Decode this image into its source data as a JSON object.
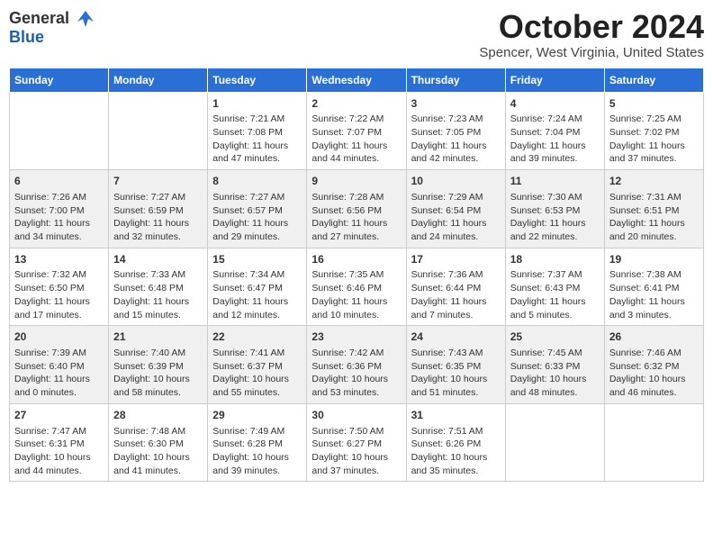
{
  "header": {
    "logo_line1": "General",
    "logo_line2": "Blue",
    "month_title": "October 2024",
    "location": "Spencer, West Virginia, United States"
  },
  "weekdays": [
    "Sunday",
    "Monday",
    "Tuesday",
    "Wednesday",
    "Thursday",
    "Friday",
    "Saturday"
  ],
  "weeks": [
    [
      {
        "day": "",
        "info": ""
      },
      {
        "day": "",
        "info": ""
      },
      {
        "day": "1",
        "info": "Sunrise: 7:21 AM\nSunset: 7:08 PM\nDaylight: 11 hours and 47 minutes."
      },
      {
        "day": "2",
        "info": "Sunrise: 7:22 AM\nSunset: 7:07 PM\nDaylight: 11 hours and 44 minutes."
      },
      {
        "day": "3",
        "info": "Sunrise: 7:23 AM\nSunset: 7:05 PM\nDaylight: 11 hours and 42 minutes."
      },
      {
        "day": "4",
        "info": "Sunrise: 7:24 AM\nSunset: 7:04 PM\nDaylight: 11 hours and 39 minutes."
      },
      {
        "day": "5",
        "info": "Sunrise: 7:25 AM\nSunset: 7:02 PM\nDaylight: 11 hours and 37 minutes."
      }
    ],
    [
      {
        "day": "6",
        "info": "Sunrise: 7:26 AM\nSunset: 7:00 PM\nDaylight: 11 hours and 34 minutes."
      },
      {
        "day": "7",
        "info": "Sunrise: 7:27 AM\nSunset: 6:59 PM\nDaylight: 11 hours and 32 minutes."
      },
      {
        "day": "8",
        "info": "Sunrise: 7:27 AM\nSunset: 6:57 PM\nDaylight: 11 hours and 29 minutes."
      },
      {
        "day": "9",
        "info": "Sunrise: 7:28 AM\nSunset: 6:56 PM\nDaylight: 11 hours and 27 minutes."
      },
      {
        "day": "10",
        "info": "Sunrise: 7:29 AM\nSunset: 6:54 PM\nDaylight: 11 hours and 24 minutes."
      },
      {
        "day": "11",
        "info": "Sunrise: 7:30 AM\nSunset: 6:53 PM\nDaylight: 11 hours and 22 minutes."
      },
      {
        "day": "12",
        "info": "Sunrise: 7:31 AM\nSunset: 6:51 PM\nDaylight: 11 hours and 20 minutes."
      }
    ],
    [
      {
        "day": "13",
        "info": "Sunrise: 7:32 AM\nSunset: 6:50 PM\nDaylight: 11 hours and 17 minutes."
      },
      {
        "day": "14",
        "info": "Sunrise: 7:33 AM\nSunset: 6:48 PM\nDaylight: 11 hours and 15 minutes."
      },
      {
        "day": "15",
        "info": "Sunrise: 7:34 AM\nSunset: 6:47 PM\nDaylight: 11 hours and 12 minutes."
      },
      {
        "day": "16",
        "info": "Sunrise: 7:35 AM\nSunset: 6:46 PM\nDaylight: 11 hours and 10 minutes."
      },
      {
        "day": "17",
        "info": "Sunrise: 7:36 AM\nSunset: 6:44 PM\nDaylight: 11 hours and 7 minutes."
      },
      {
        "day": "18",
        "info": "Sunrise: 7:37 AM\nSunset: 6:43 PM\nDaylight: 11 hours and 5 minutes."
      },
      {
        "day": "19",
        "info": "Sunrise: 7:38 AM\nSunset: 6:41 PM\nDaylight: 11 hours and 3 minutes."
      }
    ],
    [
      {
        "day": "20",
        "info": "Sunrise: 7:39 AM\nSunset: 6:40 PM\nDaylight: 11 hours and 0 minutes."
      },
      {
        "day": "21",
        "info": "Sunrise: 7:40 AM\nSunset: 6:39 PM\nDaylight: 10 hours and 58 minutes."
      },
      {
        "day": "22",
        "info": "Sunrise: 7:41 AM\nSunset: 6:37 PM\nDaylight: 10 hours and 55 minutes."
      },
      {
        "day": "23",
        "info": "Sunrise: 7:42 AM\nSunset: 6:36 PM\nDaylight: 10 hours and 53 minutes."
      },
      {
        "day": "24",
        "info": "Sunrise: 7:43 AM\nSunset: 6:35 PM\nDaylight: 10 hours and 51 minutes."
      },
      {
        "day": "25",
        "info": "Sunrise: 7:45 AM\nSunset: 6:33 PM\nDaylight: 10 hours and 48 minutes."
      },
      {
        "day": "26",
        "info": "Sunrise: 7:46 AM\nSunset: 6:32 PM\nDaylight: 10 hours and 46 minutes."
      }
    ],
    [
      {
        "day": "27",
        "info": "Sunrise: 7:47 AM\nSunset: 6:31 PM\nDaylight: 10 hours and 44 minutes."
      },
      {
        "day": "28",
        "info": "Sunrise: 7:48 AM\nSunset: 6:30 PM\nDaylight: 10 hours and 41 minutes."
      },
      {
        "day": "29",
        "info": "Sunrise: 7:49 AM\nSunset: 6:28 PM\nDaylight: 10 hours and 39 minutes."
      },
      {
        "day": "30",
        "info": "Sunrise: 7:50 AM\nSunset: 6:27 PM\nDaylight: 10 hours and 37 minutes."
      },
      {
        "day": "31",
        "info": "Sunrise: 7:51 AM\nSunset: 6:26 PM\nDaylight: 10 hours and 35 minutes."
      },
      {
        "day": "",
        "info": ""
      },
      {
        "day": "",
        "info": ""
      }
    ]
  ],
  "alt_rows": [
    1,
    3
  ]
}
